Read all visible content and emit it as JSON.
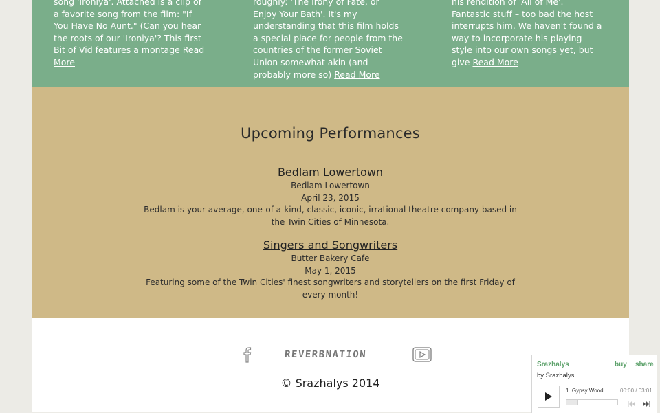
{
  "blog": {
    "columns": [
      {
        "text": "song 'Ironiya'. Attached is a clip of a favorite song from the film: \"If You Have No Aunt.\" (Can you hear the roots of our 'Ironiya'? This first Bit of Vid features a montage ",
        "read_more": "Read More"
      },
      {
        "text": "roughly: 'The Irony of Fate, or Enjoy Your Bath'. It's my understanding that this film holds a special place for people from the countries of the former Soviet Union somewhat akin (and probably more so) ",
        "read_more": "Read More"
      },
      {
        "text": "his rendition of 'All of Me'. Fantastic stuff – too bad the host interrupts him. We haven't found a way to incorporate his playing style into our own songs yet, but give ",
        "read_more": "Read More"
      }
    ]
  },
  "performances": {
    "heading": "Upcoming Performances",
    "events": [
      {
        "title": "Bedlam Lowertown",
        "venue": "Bedlam Lowertown",
        "date": "April 23, 2015",
        "description": "Bedlam is your average, one-of-a-kind, classic, iconic, irrational theatre company based in the Twin Cities of Minnesota."
      },
      {
        "title": "Singers and Songwriters",
        "venue": "Butter Bakery Cafe",
        "date": "May 1, 2015",
        "description": "Featuring some of the Twin Cities' finest songwriters and storytellers on the first Friday of every month!"
      }
    ]
  },
  "footer": {
    "social": {
      "facebook_icon": "facebook-icon",
      "reverbnation_label": "REVERBNATION",
      "youtube_icon": "youtube-icon"
    },
    "copyright": "© Srazhalys 2014"
  },
  "player": {
    "artist": "Srazhalys",
    "by_line": "by Srazhalys",
    "buy_label": "buy",
    "share_label": "share",
    "track": "1.  Gypsy Wood",
    "time": "00:00 / 03:01",
    "progress": 0,
    "icons": [
      "play-icon",
      "previous-icon",
      "next-icon"
    ],
    "accent_color": "#5ea26c"
  },
  "colors": {
    "green_section": "#7aae8a",
    "tan_section": "#cfb987",
    "footer_bg": "#ffffff",
    "page_bg": "#ecebe6"
  }
}
